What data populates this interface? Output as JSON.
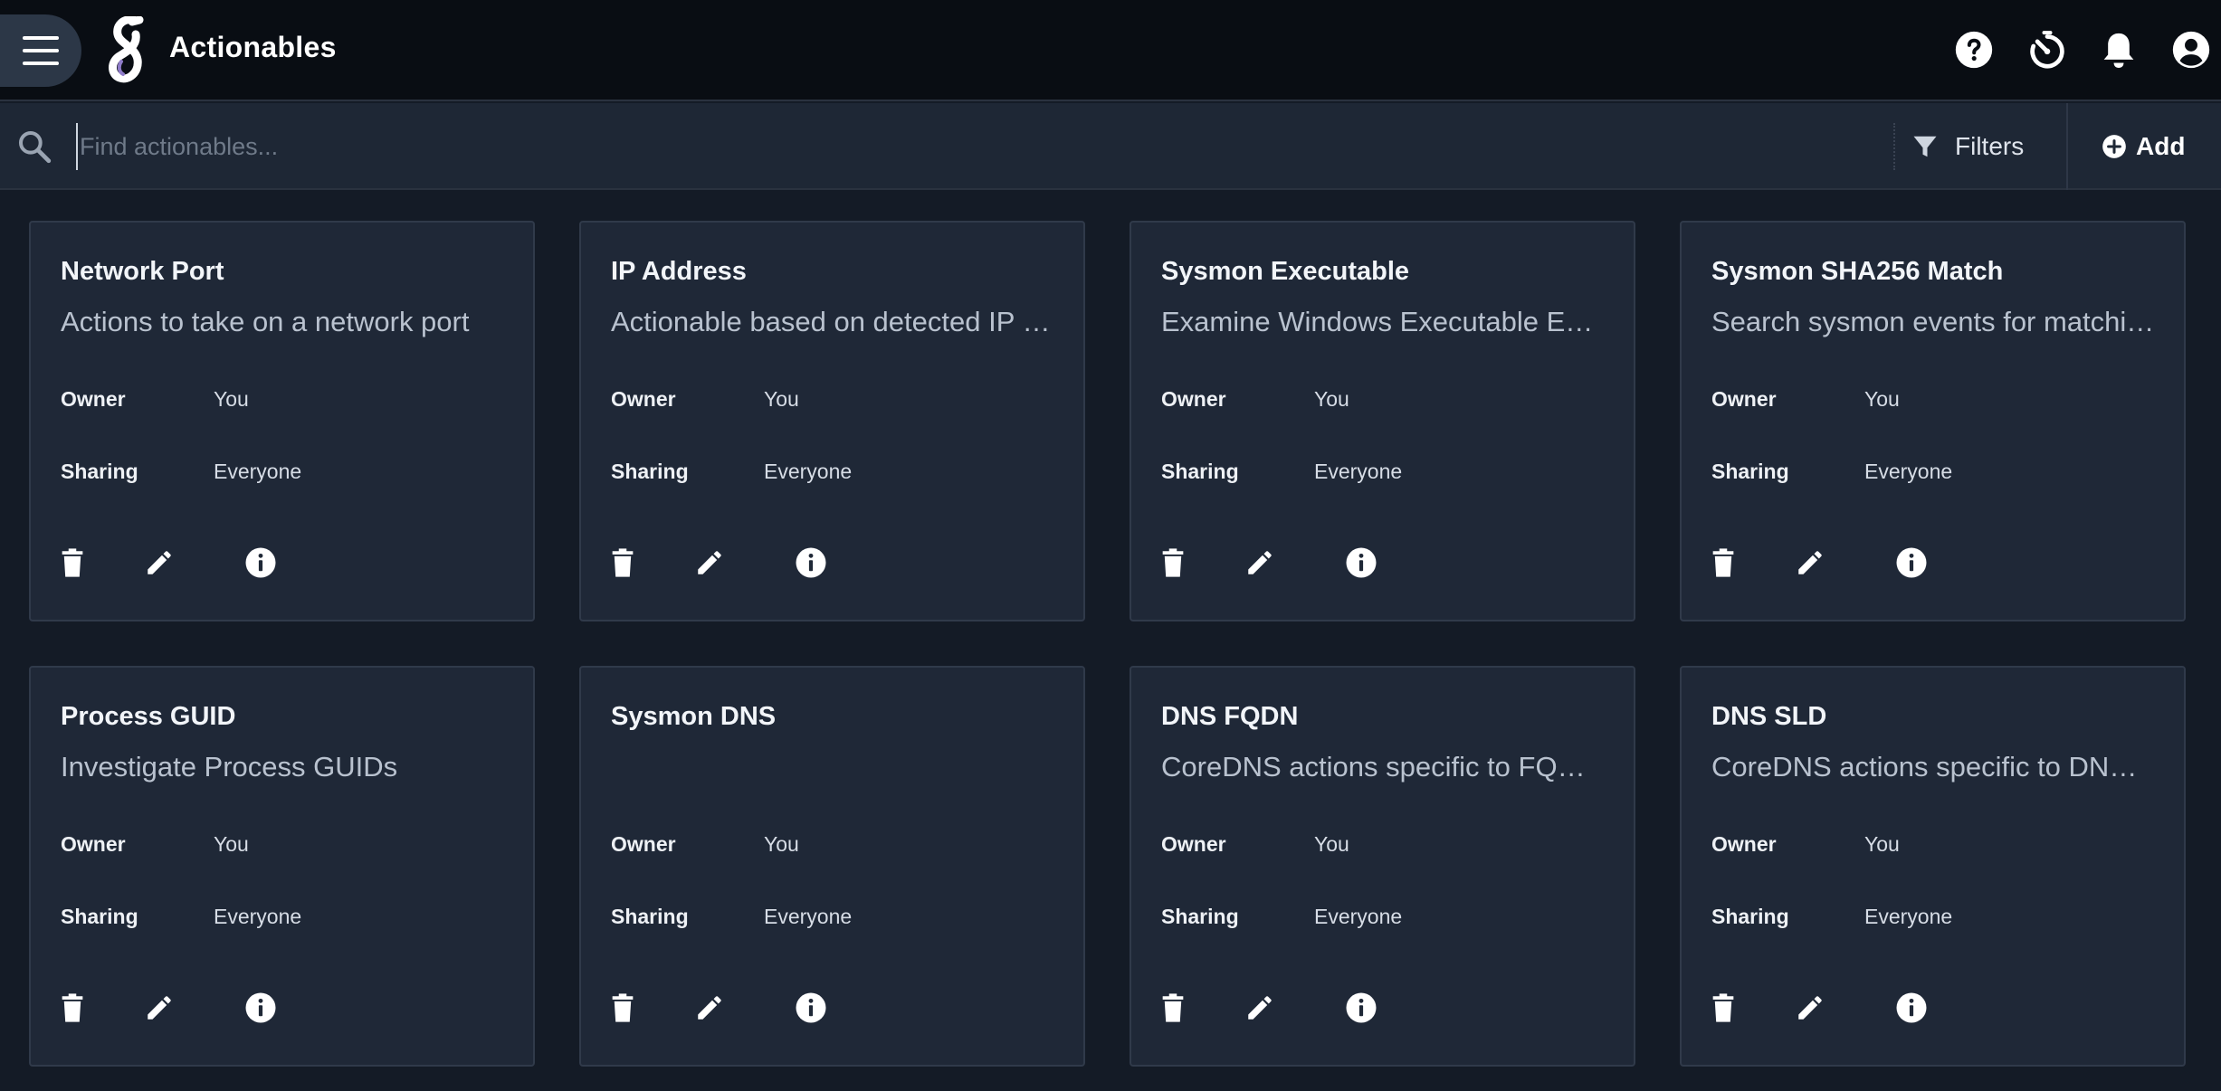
{
  "header": {
    "title": "Actionables",
    "icons": [
      "menu-icon",
      "logo",
      "help-icon",
      "timer-icon",
      "bell-icon",
      "account-icon"
    ]
  },
  "search": {
    "placeholder": "Find actionables...",
    "value": "",
    "filters_label": "Filters",
    "add_label": "Add"
  },
  "labels": {
    "owner": "Owner",
    "sharing": "Sharing"
  },
  "cards": [
    {
      "title": "Network Port",
      "description": "Actions to take on a network port",
      "owner": "You",
      "sharing": "Everyone"
    },
    {
      "title": "IP Address",
      "description": "Actionable based on detected IP address",
      "owner": "You",
      "sharing": "Everyone"
    },
    {
      "title": "Sysmon Executable",
      "description": "Examine Windows Executable Events",
      "owner": "You",
      "sharing": "Everyone"
    },
    {
      "title": "Sysmon SHA256 Match",
      "description": "Search sysmon events for matching hashes",
      "owner": "You",
      "sharing": "Everyone"
    },
    {
      "title": "Process GUID",
      "description": "Investigate Process GUIDs",
      "owner": "You",
      "sharing": "Everyone"
    },
    {
      "title": "Sysmon DNS",
      "description": "",
      "owner": "You",
      "sharing": "Everyone"
    },
    {
      "title": "DNS FQDN",
      "description": "CoreDNS actions specific to FQDNs",
      "owner": "You",
      "sharing": "Everyone"
    },
    {
      "title": "DNS SLD",
      "description": "CoreDNS actions specific to DNS SLDs",
      "owner": "You",
      "sharing": "Everyone"
    }
  ],
  "colors": {
    "topbar": "#090d13",
    "background": "#141b26",
    "card": "#1f2837",
    "searchbar": "#1e2735",
    "menu_button": "#2c3747"
  }
}
